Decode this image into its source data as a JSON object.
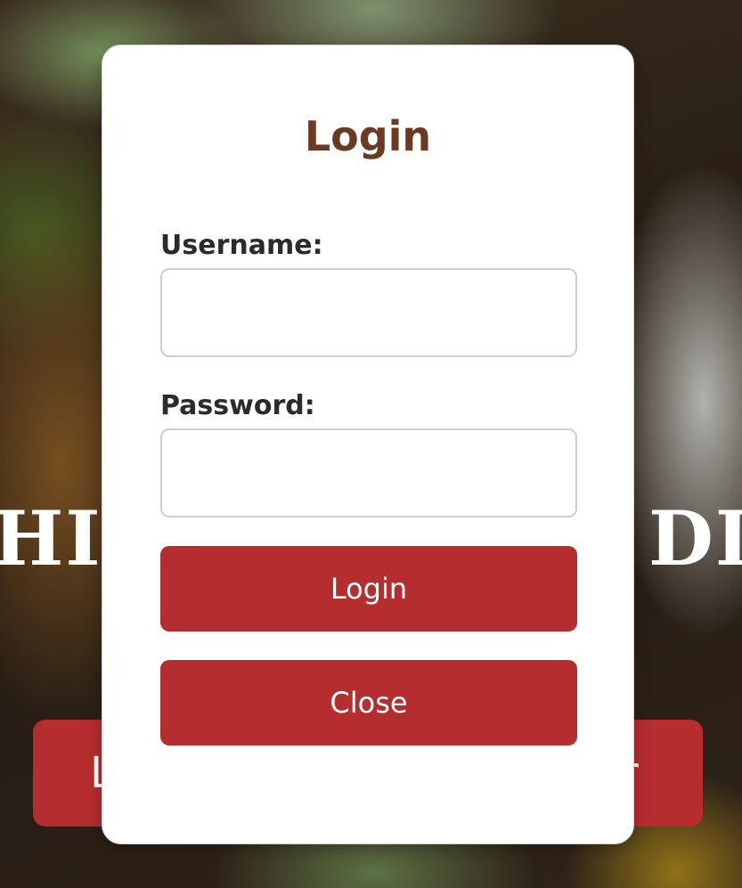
{
  "background": {
    "title_left": "HID",
    "title_right": "DI",
    "button_left_text": "L",
    "button_right_text": "r"
  },
  "modal": {
    "title": "Login",
    "username_label": "Username:",
    "username_value": "",
    "password_label": "Password:",
    "password_value": "",
    "login_button": "Login",
    "close_button": "Close"
  },
  "colors": {
    "accent": "#b62d2f",
    "title": "#6b3a22"
  }
}
